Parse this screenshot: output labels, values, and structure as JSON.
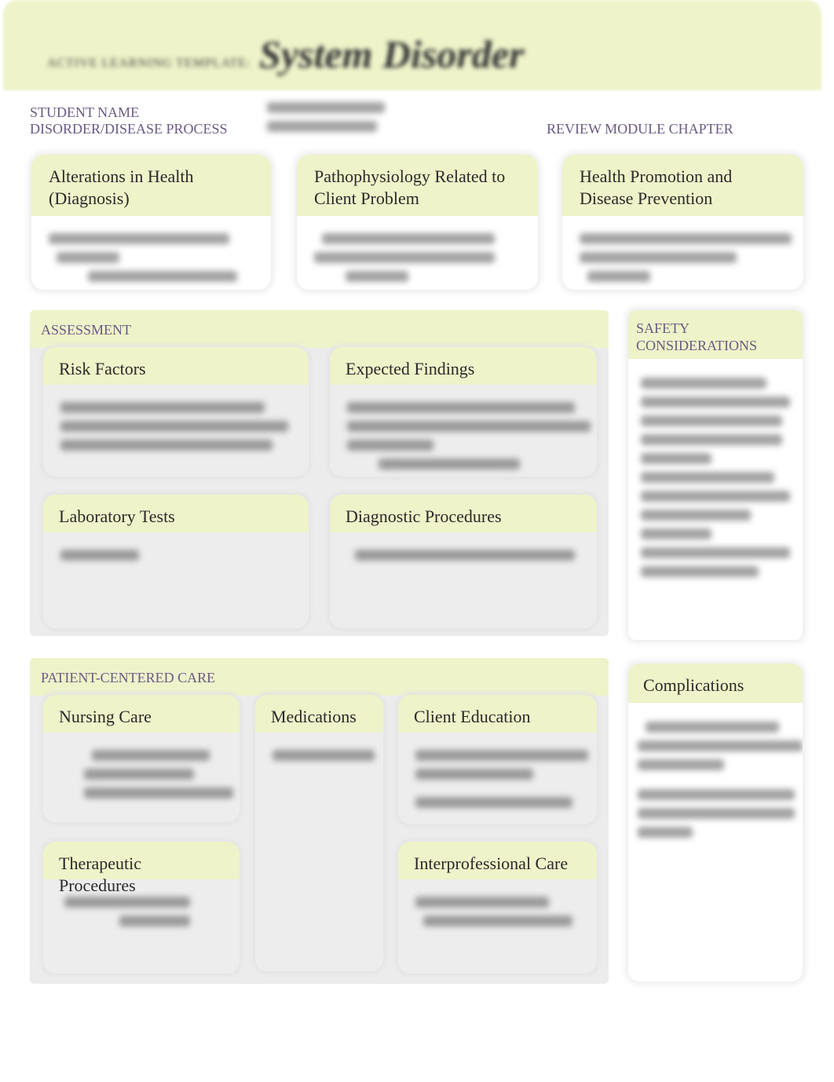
{
  "header": {
    "prefix": "ACTIVE LEARNING TEMPLATE:",
    "title": "System Disorder"
  },
  "fields": {
    "student_name": "STUDENT NAME",
    "disorder": "DISORDER/DISEASE PROCESS",
    "review_module": "REVIEW MODULE CHAPTER"
  },
  "top_cards": [
    {
      "title": "Alterations in Health (Diagnosis)"
    },
    {
      "title": "Pathophysiology Related to Client Problem"
    },
    {
      "title": "Health Promotion and Disease Prevention"
    }
  ],
  "assessment": {
    "label": "ASSESSMENT",
    "risk_factors": "Risk Factors",
    "expected_findings": "Expected Findings",
    "laboratory_tests": "Laboratory Tests",
    "diagnostic_procedures": "Diagnostic Procedures"
  },
  "safety": {
    "label": "SAFETY CONSIDERATIONS"
  },
  "pcc": {
    "label": "PATIENT-CENTERED CARE",
    "nursing_care": "Nursing Care",
    "medications": "Medications",
    "client_education": "Client Education",
    "therapeutic_procedures": "Therapeutic Procedures",
    "interprofessional_care": "Interprofessional Care"
  },
  "complications": {
    "title": "Complications"
  },
  "colors": {
    "header_band": "#eef3c9",
    "label_purple": "#6b5a85",
    "section_gray": "#ececec"
  }
}
